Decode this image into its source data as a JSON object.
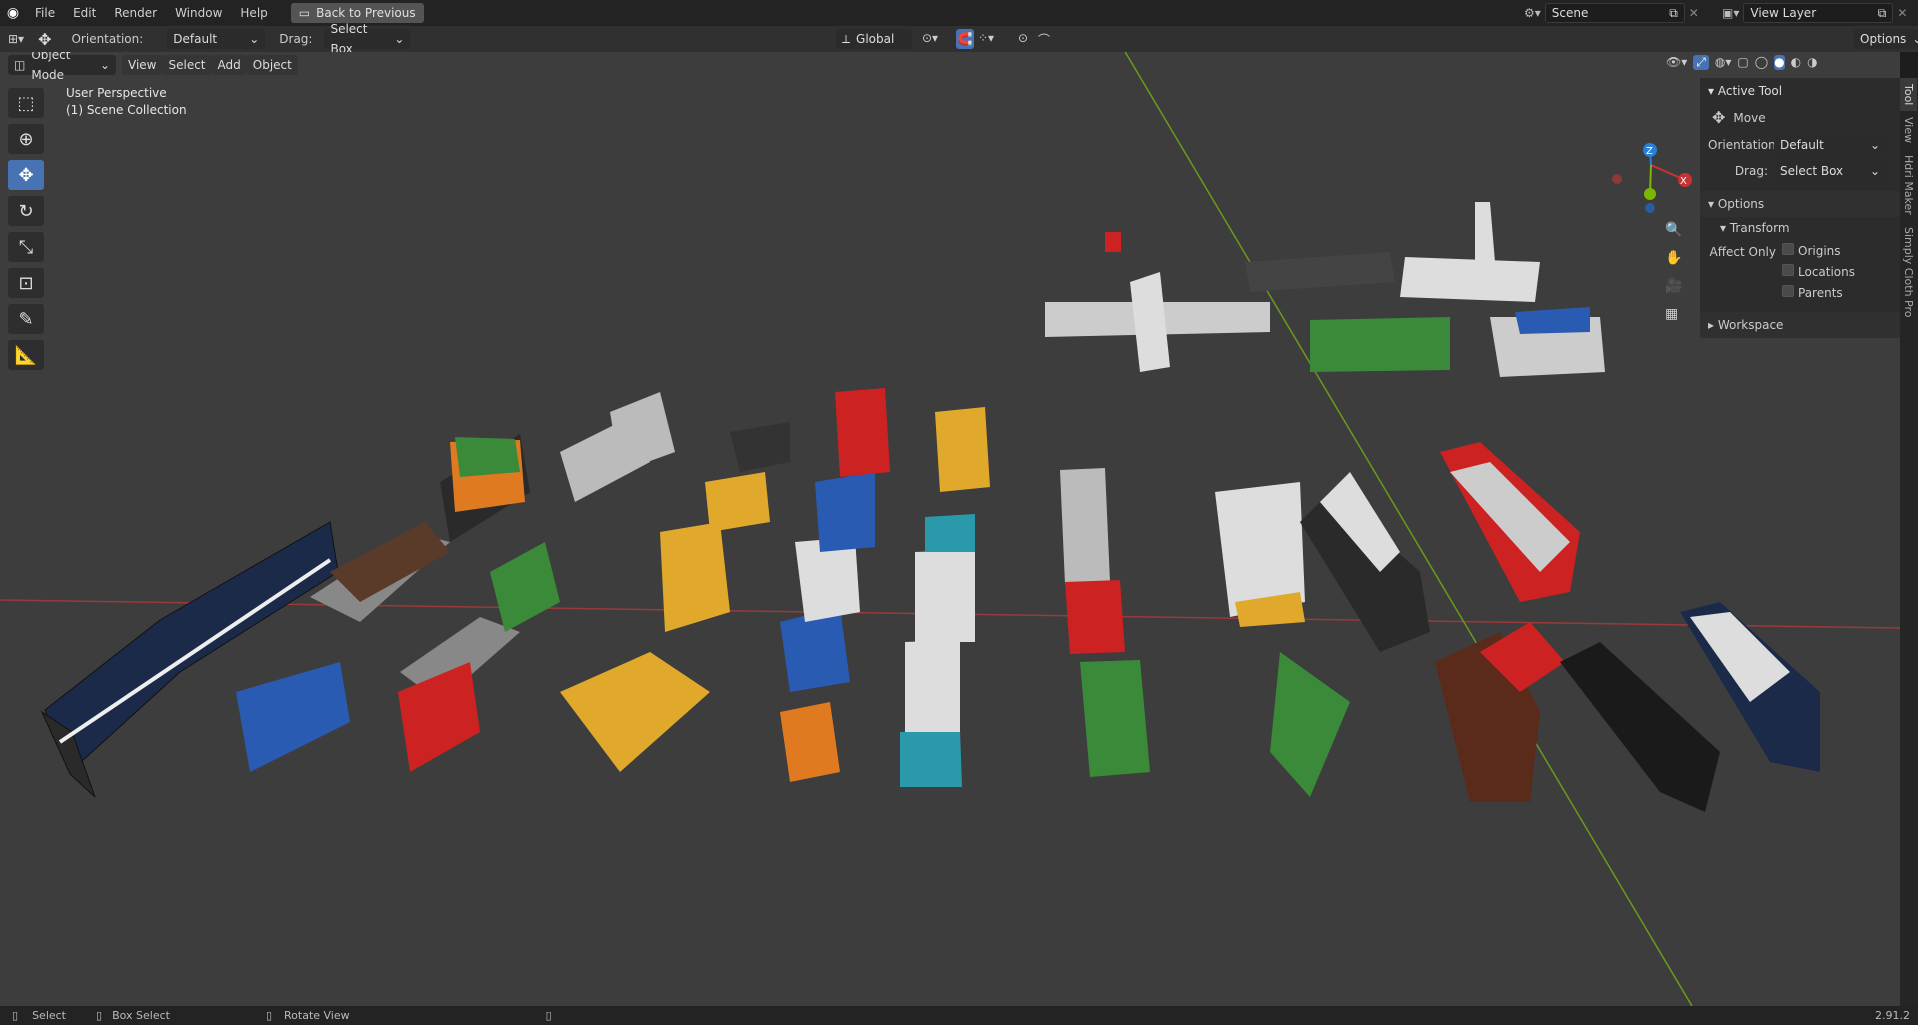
{
  "menu": {
    "file": "File",
    "edit": "Edit",
    "render": "Render",
    "window": "Window",
    "help": "Help",
    "back": "Back to Previous"
  },
  "scene": {
    "label": "Scene",
    "view_layer": "View Layer"
  },
  "header": {
    "orientation_label": "Orientation:",
    "orientation_value": "Default",
    "drag_label": "Drag:",
    "drag_value": "Select Box",
    "transform": "Global",
    "options": "Options"
  },
  "viewport_header": {
    "mode": "Object Mode",
    "view": "View",
    "select": "Select",
    "add": "Add",
    "object": "Object"
  },
  "viewport": {
    "perspective": "User Perspective",
    "collection": "(1) Scene Collection"
  },
  "panel": {
    "active_tool": "Active Tool",
    "tool_name": "Move",
    "orientation_label": "Orientation",
    "orientation_value": "Default",
    "drag_label": "Drag:",
    "drag_value": "Select Box",
    "options": "Options",
    "transform": "Transform",
    "affect_only": "Affect Only",
    "origins": "Origins",
    "locations": "Locations",
    "parents": "Parents",
    "workspace": "Workspace"
  },
  "tabs": [
    "Tool",
    "View",
    "Hdri Maker",
    "Simply Cloth Pro"
  ],
  "gizmo": {
    "x": "X",
    "y": "Y",
    "z": "Z"
  },
  "status": {
    "select": "Select",
    "box_select": "Box Select",
    "rotate_view": "Rotate View",
    "version": "2.91.2"
  },
  "colors": {
    "accent": "#4772b3",
    "x_axis": "#c83232",
    "y_axis": "#7ab800",
    "z_axis": "#2a7fd6"
  }
}
